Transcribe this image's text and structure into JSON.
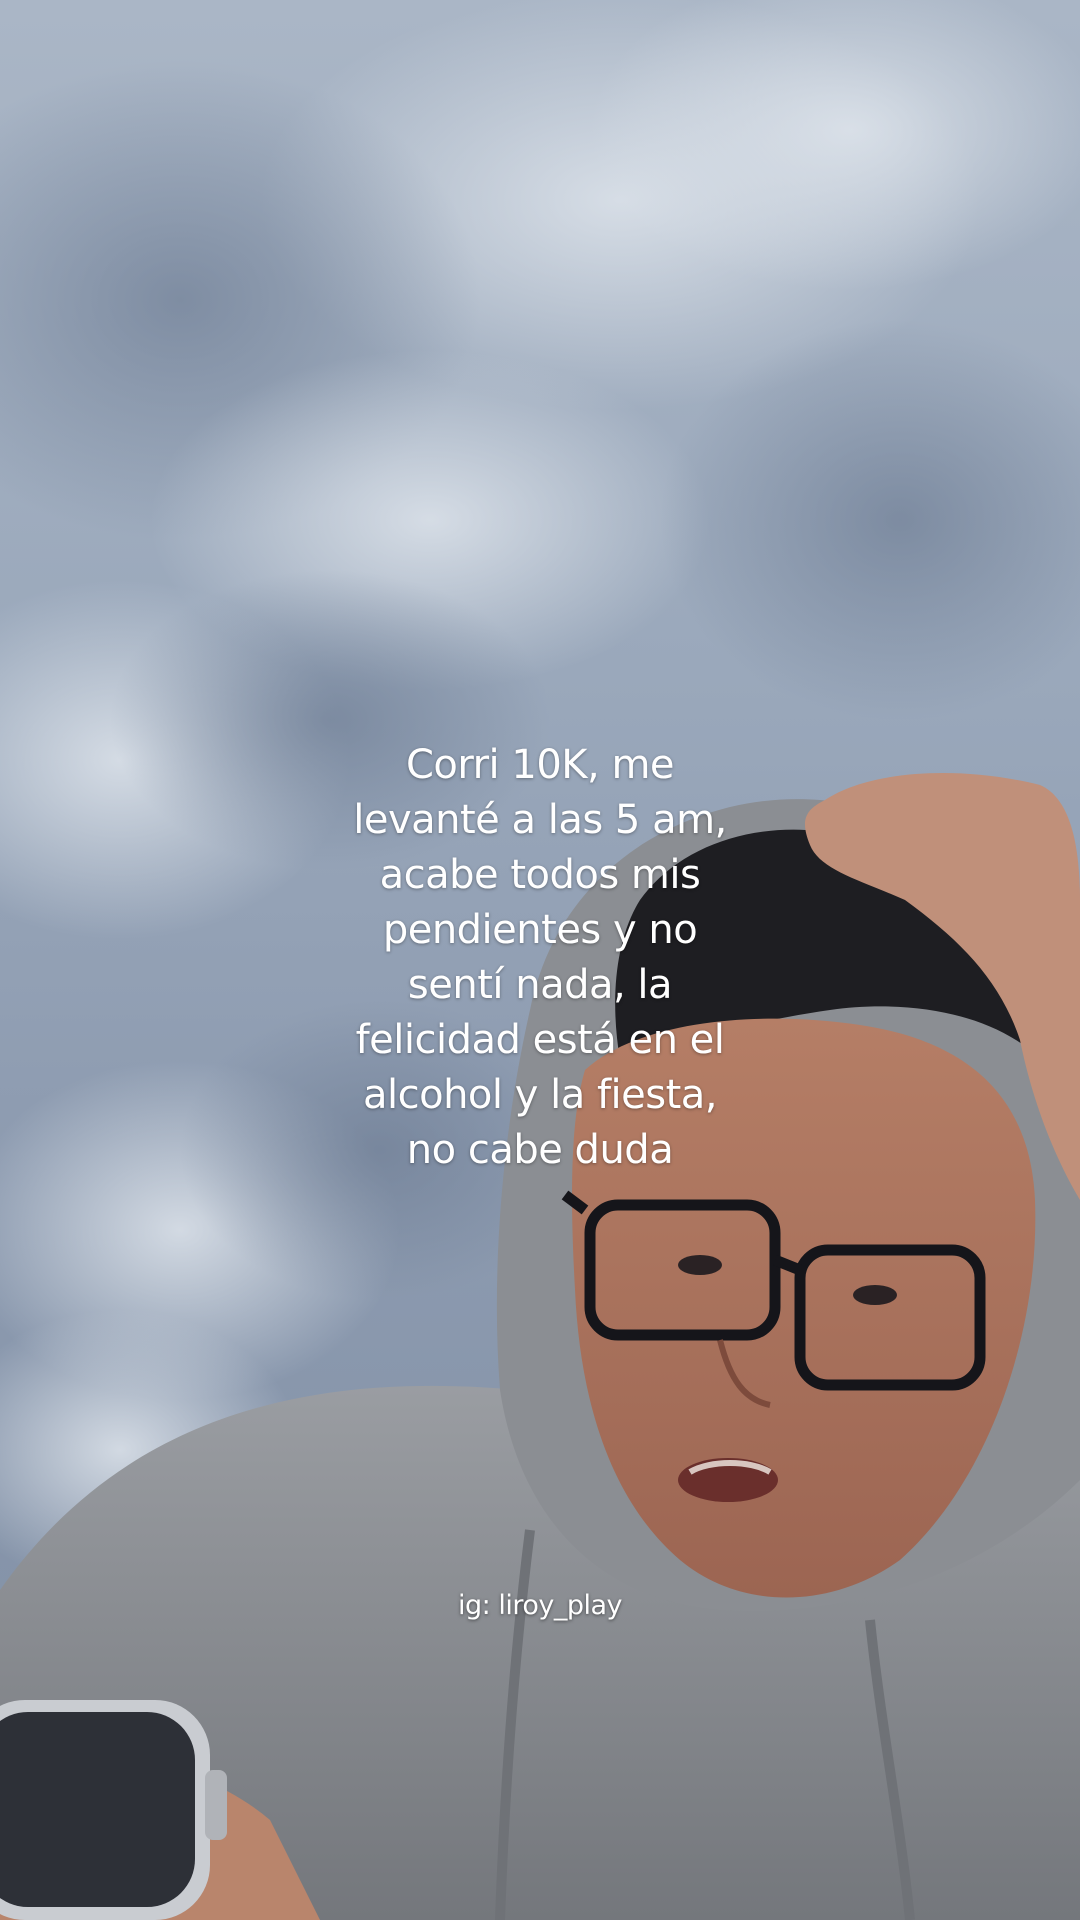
{
  "video": {
    "caption_lines": [
      "Corri 10K, me",
      "levanté a las 5 am,",
      "acabe todos mis",
      "pendientes y no",
      "sentí nada, la",
      "felicidad está en el",
      "alcohol y la fiesta,",
      "no cabe duda"
    ],
    "watermark": "ig: liroy_play"
  },
  "colors": {
    "sky": "#9aa8bb",
    "hoodie": "#8a8d92",
    "skin": "#c98f74",
    "hair": "#1e1e22",
    "text": "#ffffff"
  }
}
